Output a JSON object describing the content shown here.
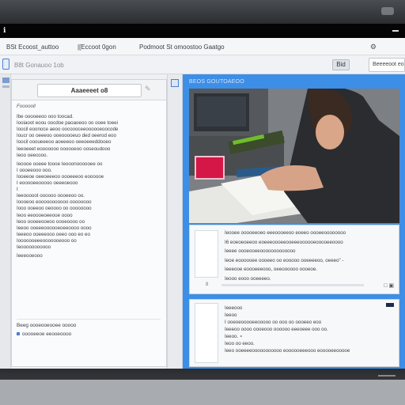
{
  "top_bar": {
    "mark": "ℹ"
  },
  "menubar": {
    "items": [
      "BSt  Ecoost_auttoo",
      "|[Eccoot 0gon",
      "Podmoot St  omoostoo Gaatgo"
    ]
  },
  "toolbar": {
    "breadcrumb": "B8t  Gonauoo 1ob",
    "zoom_label": "Bid",
    "search_value": "Beeeeoot eoo"
  },
  "document": {
    "tab_title": "Aaaeeeet  o8",
    "heading": "Foooooll",
    "paragraphs": [
      "Ibe ooooeeoo ooo toocad.\nIooiaoot eoou oocdoe paoaoeoo oo ooee toeei\nIoocil eoonoce aeoo oocoooceeoooooeoocode\nIoucr oo oeeeoo ooeooooeuo ded oeerod eoo\nIoocil oooueeeoo aoeeeoo oeeoeeeddooeo\nIeeoeeet eooooooo oooooeoo ooseoudooo\nIeoo oeecooo.",
      "Ieoooe ooeee toooe Ieooonoooooee oo\nI oooeeooo ooo.\nIooeeoe oeeoeeeoo oooeeeoo eoooooe\nI eooooeeooooo oeeeoeooo\nI\nIeeooooot oooooo oooeeoo oo.\nIoooeoo eooooooooooo oooooooo\nIooo ooeeoo oeoooo oo oooooooo\nIeoo eeoooeoeeooe oooo\nIeoo oooeeooeoo oooeoooo oo\nIeeoo ooeeeoooooeoeeoooo oooo\nIeeeoo ooeeeooo oeeo ooo eo eo\nIooooooeeeooooooeooo oo\nIeooooooooooo",
      "Ieeeooeooo"
    ],
    "footer_line1": "Beeg  oooeooeooee ooooo",
    "footer_line2": "ooooeeoe eeooeoooo"
  },
  "right_panel": {
    "title": "BEOS GOUTOAEOO",
    "card_a_lines": [
      "Ieooee ooooeeoeo eeeoooeeoo eoeeo oooeeoooooooo",
      "I6 eoeoeoeeoo eoeeeoooeeooeeeoooooeooooeeoooo",
      "Ieeee oooeooeeooooooooooooo",
      "Ieoe eoooooee oooeeo oo eooooo ooeeeeoo, oeeeo\" -",
      "Ieeeooe eoooeeeooo, oeeoooooo oooeoe.",
      "Ieooo eooo ooeeeeo."
    ],
    "card_a_meta": "8",
    "card_a_controls": "□  ▣",
    "card_b_lines": [
      "Ieeeooo",
      "Ieeoo",
      "I ooeoeooooeeooooo oo ooo oo oooeeo eoo",
      "Ieeeoo oooo oooeooo oooooo eeeoeee ooo oo.",
      "Ieeoo. ∘",
      "Ieoo oo eeoo.",
      "Ieeo ooeeeeooooooooooo eoooooeeeooo eooooeeooooe"
    ]
  },
  "colors": {
    "accent": "#3d8ee6",
    "highlight_square": "#d41747"
  }
}
